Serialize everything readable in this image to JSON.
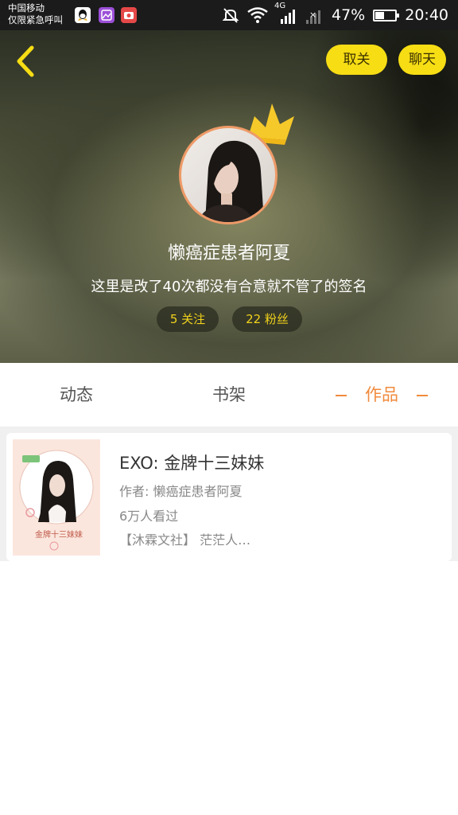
{
  "status_bar": {
    "carrier_line1": "中国移动",
    "carrier_line2": "仅限紧急呼叫",
    "network": "4G",
    "battery": "47%",
    "battery_level": 0.47,
    "time": "20:40",
    "icons": [
      "qq-icon",
      "gallery-app-icon",
      "camera-app-icon",
      "mute-icon",
      "wifi-icon",
      "signal-icon",
      "no-sim-signal-icon",
      "battery-icon"
    ]
  },
  "profile": {
    "back_icon": "chevron-left-icon",
    "unfollow_label": "取关",
    "chat_label": "聊天",
    "crown_icon": "crown-icon",
    "username": "懒癌症患者阿夏",
    "signature": "这里是改了40次都没有合意就不管了的签名",
    "following_label": "5 关注",
    "followers_label": "22 粉丝",
    "accent_color": "#f6dd14",
    "avatar_border_color": "#ee9a67"
  },
  "tabs": [
    {
      "label": "动态",
      "active": false
    },
    {
      "label": "书架",
      "active": false
    },
    {
      "label": "作品",
      "active": true
    }
  ],
  "active_tab_color": "#f08a3c",
  "works": [
    {
      "title": "EXO: 金牌十三妹妹",
      "author": "作者: 懒癌症患者阿夏",
      "views": "6万人看过",
      "tags": "【沐霖文社】 茫茫人…",
      "cover_text": "金牌十三妹妹"
    }
  ]
}
